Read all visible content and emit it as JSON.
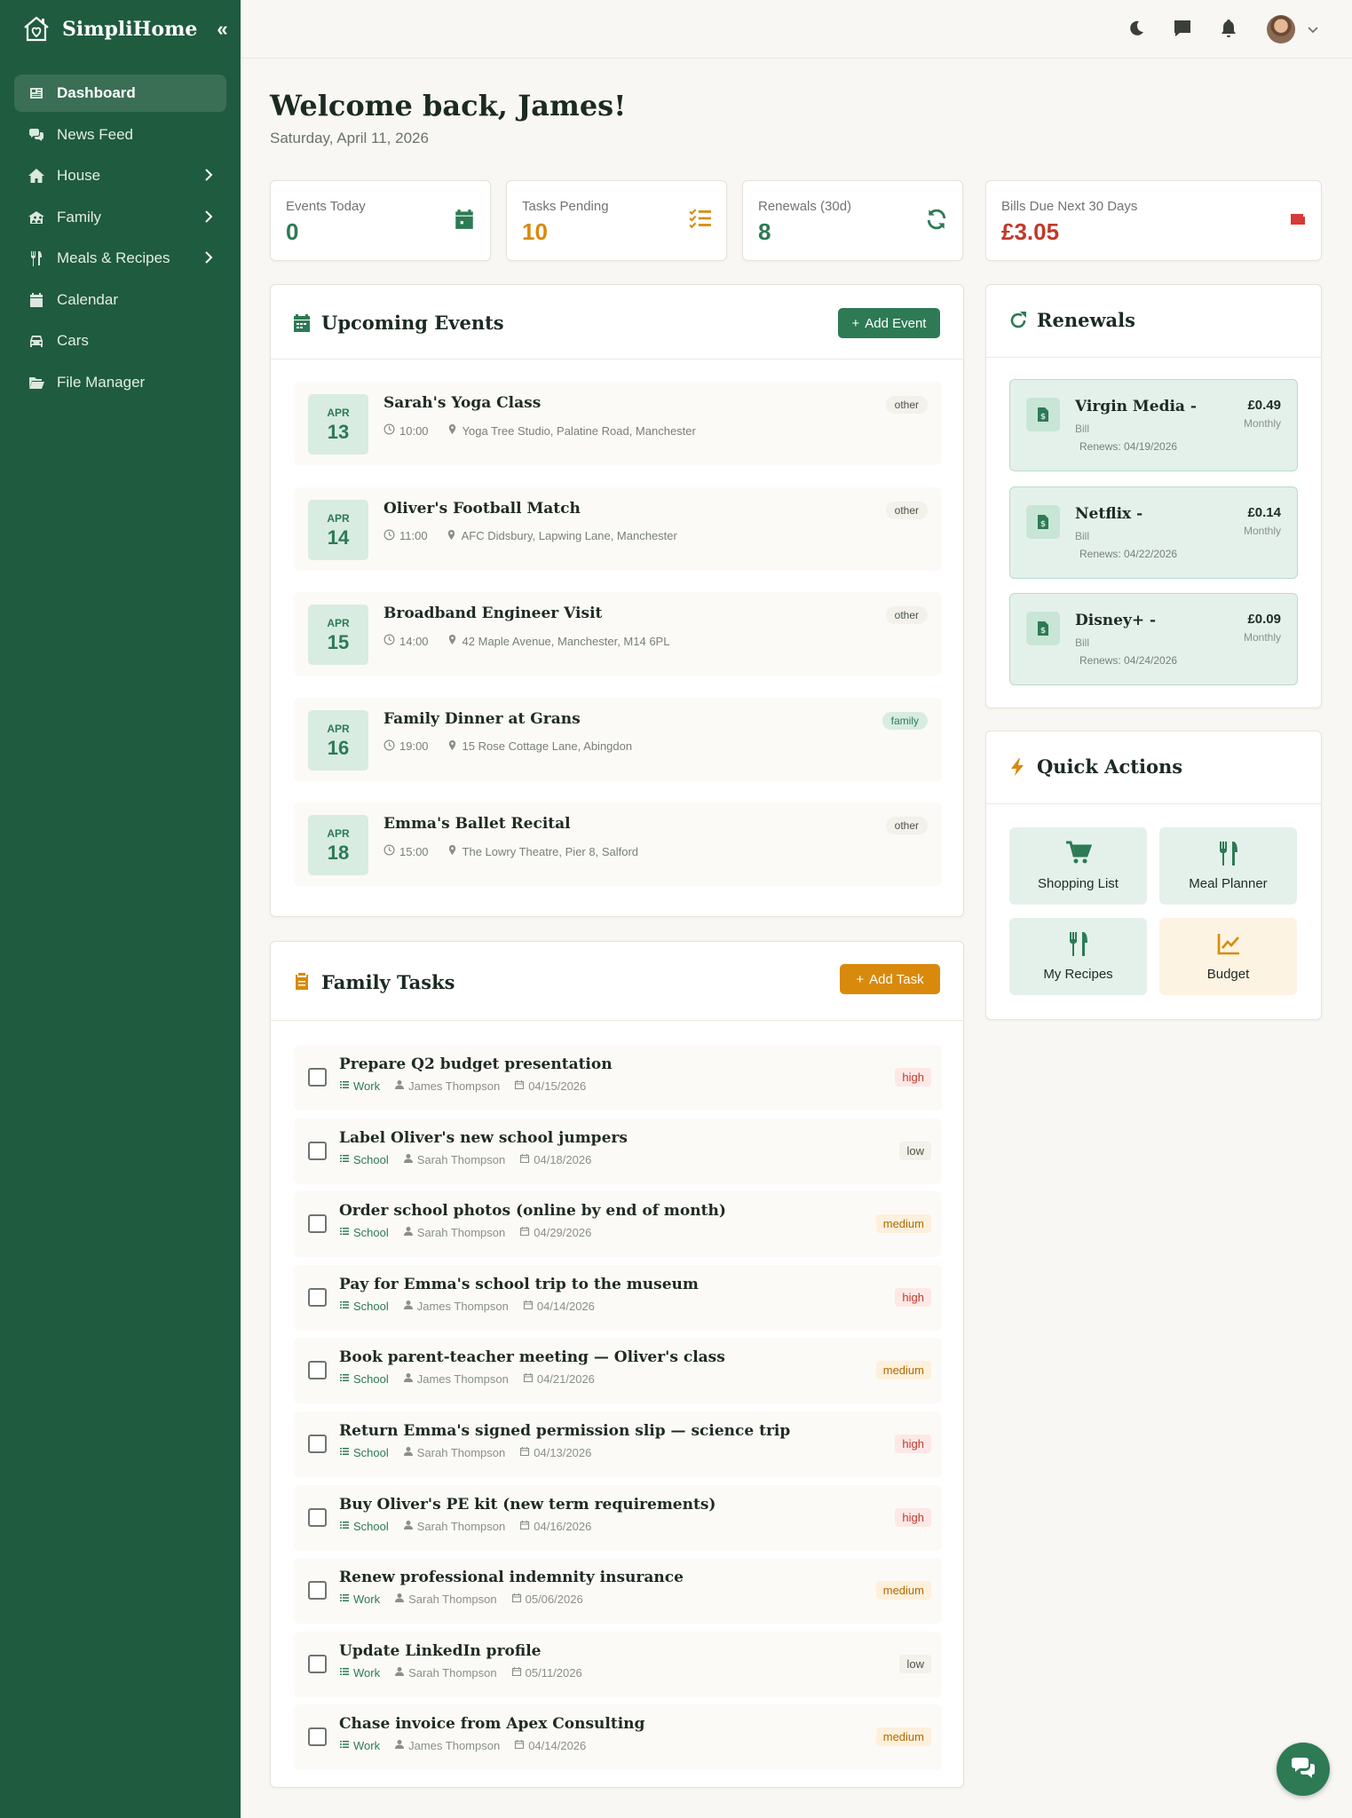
{
  "brand": {
    "name": "SimpliHome"
  },
  "nav": [
    {
      "label": "Dashboard",
      "icon": "dashboard-icon",
      "active": true
    },
    {
      "label": "News Feed",
      "icon": "news-icon"
    },
    {
      "label": "House",
      "icon": "house-icon",
      "submenu": true
    },
    {
      "label": "Family",
      "icon": "family-icon",
      "submenu": true
    },
    {
      "label": "Meals & Recipes",
      "icon": "utensils-icon",
      "submenu": true
    },
    {
      "label": "Calendar",
      "icon": "calendar-icon"
    },
    {
      "label": "Cars",
      "icon": "car-icon"
    },
    {
      "label": "File Manager",
      "icon": "folder-icon"
    }
  ],
  "header": {
    "welcome": "Welcome back, James!",
    "date": "Saturday, April 11, 2026"
  },
  "stats": [
    {
      "label": "Events Today",
      "value": "0",
      "color": "#2d7a55"
    },
    {
      "label": "Tasks Pending",
      "value": "10",
      "color": "#d98a0c"
    },
    {
      "label": "Renewals (30d)",
      "value": "8",
      "color": "#2d7a55"
    },
    {
      "label": "Bills Due Next 30 Days",
      "value": "£3.05",
      "color": "#c0392b"
    }
  ],
  "events": {
    "title": "Upcoming Events",
    "add_label": "Add Event",
    "items": [
      {
        "month": "APR",
        "day": "13",
        "title": "Sarah's Yoga Class",
        "time": "10:00",
        "location": "Yoga Tree Studio, Palatine Road, Manchester",
        "tag": "other"
      },
      {
        "month": "APR",
        "day": "14",
        "title": "Oliver's Football Match",
        "time": "11:00",
        "location": "AFC Didsbury, Lapwing Lane, Manchester",
        "tag": "other"
      },
      {
        "month": "APR",
        "day": "15",
        "title": "Broadband Engineer Visit",
        "time": "14:00",
        "location": "42 Maple Avenue, Manchester, M14 6PL",
        "tag": "other"
      },
      {
        "month": "APR",
        "day": "16",
        "title": "Family Dinner at Grans",
        "time": "19:00",
        "location": "15 Rose Cottage Lane, Abingdon",
        "tag": "family"
      },
      {
        "month": "APR",
        "day": "18",
        "title": "Emma's Ballet Recital",
        "time": "15:00",
        "location": "The Lowry Theatre, Pier 8, Salford",
        "tag": "other"
      }
    ]
  },
  "tasks": {
    "title": "Family Tasks",
    "add_label": "Add Task",
    "items": [
      {
        "title": "Prepare Q2 budget presentation",
        "category": "Work",
        "person": "James Thompson",
        "date": "04/15/2026",
        "priority": "high"
      },
      {
        "title": "Label Oliver's new school jumpers",
        "category": "School",
        "person": "Sarah Thompson",
        "date": "04/18/2026",
        "priority": "low"
      },
      {
        "title": "Order school photos (online by end of month)",
        "category": "School",
        "person": "Sarah Thompson",
        "date": "04/29/2026",
        "priority": "medium"
      },
      {
        "title": "Pay for Emma's school trip to the museum",
        "category": "School",
        "person": "James Thompson",
        "date": "04/14/2026",
        "priority": "high"
      },
      {
        "title": "Book parent-teacher meeting — Oliver's class",
        "category": "School",
        "person": "James Thompson",
        "date": "04/21/2026",
        "priority": "medium"
      },
      {
        "title": "Return Emma's signed permission slip — science trip",
        "category": "School",
        "person": "Sarah Thompson",
        "date": "04/13/2026",
        "priority": "high"
      },
      {
        "title": "Buy Oliver's PE kit (new term requirements)",
        "category": "School",
        "person": "Sarah Thompson",
        "date": "04/16/2026",
        "priority": "high"
      },
      {
        "title": "Renew professional indemnity insurance",
        "category": "Work",
        "person": "Sarah Thompson",
        "date": "05/06/2026",
        "priority": "medium"
      },
      {
        "title": "Update LinkedIn profile",
        "category": "Work",
        "person": "Sarah Thompson",
        "date": "05/11/2026",
        "priority": "low"
      },
      {
        "title": "Chase invoice from Apex Consulting",
        "category": "Work",
        "person": "James Thompson",
        "date": "04/14/2026",
        "priority": "medium"
      }
    ]
  },
  "renewals": {
    "title": "Renewals",
    "items": [
      {
        "name": "Virgin Media -",
        "type": "Bill",
        "renews": "Renews: 04/19/2026",
        "amount": "£0.49",
        "freq": "Monthly"
      },
      {
        "name": "Netflix -",
        "type": "Bill",
        "renews": "Renews: 04/22/2026",
        "amount": "£0.14",
        "freq": "Monthly"
      },
      {
        "name": "Disney+ -",
        "type": "Bill",
        "renews": "Renews: 04/24/2026",
        "amount": "£0.09",
        "freq": "Monthly"
      }
    ]
  },
  "quick_actions": {
    "title": "Quick Actions",
    "items": [
      {
        "label": "Shopping List",
        "icon": "cart-icon"
      },
      {
        "label": "Meal Planner",
        "icon": "utensils-icon"
      },
      {
        "label": "My Recipes",
        "icon": "utensils-icon"
      },
      {
        "label": "Budget",
        "icon": "chart-line-icon"
      }
    ]
  },
  "colors": {
    "primary": "#1f5b3e",
    "accent": "#2d7a55",
    "warning": "#d98a0c",
    "danger": "#c0392b"
  }
}
